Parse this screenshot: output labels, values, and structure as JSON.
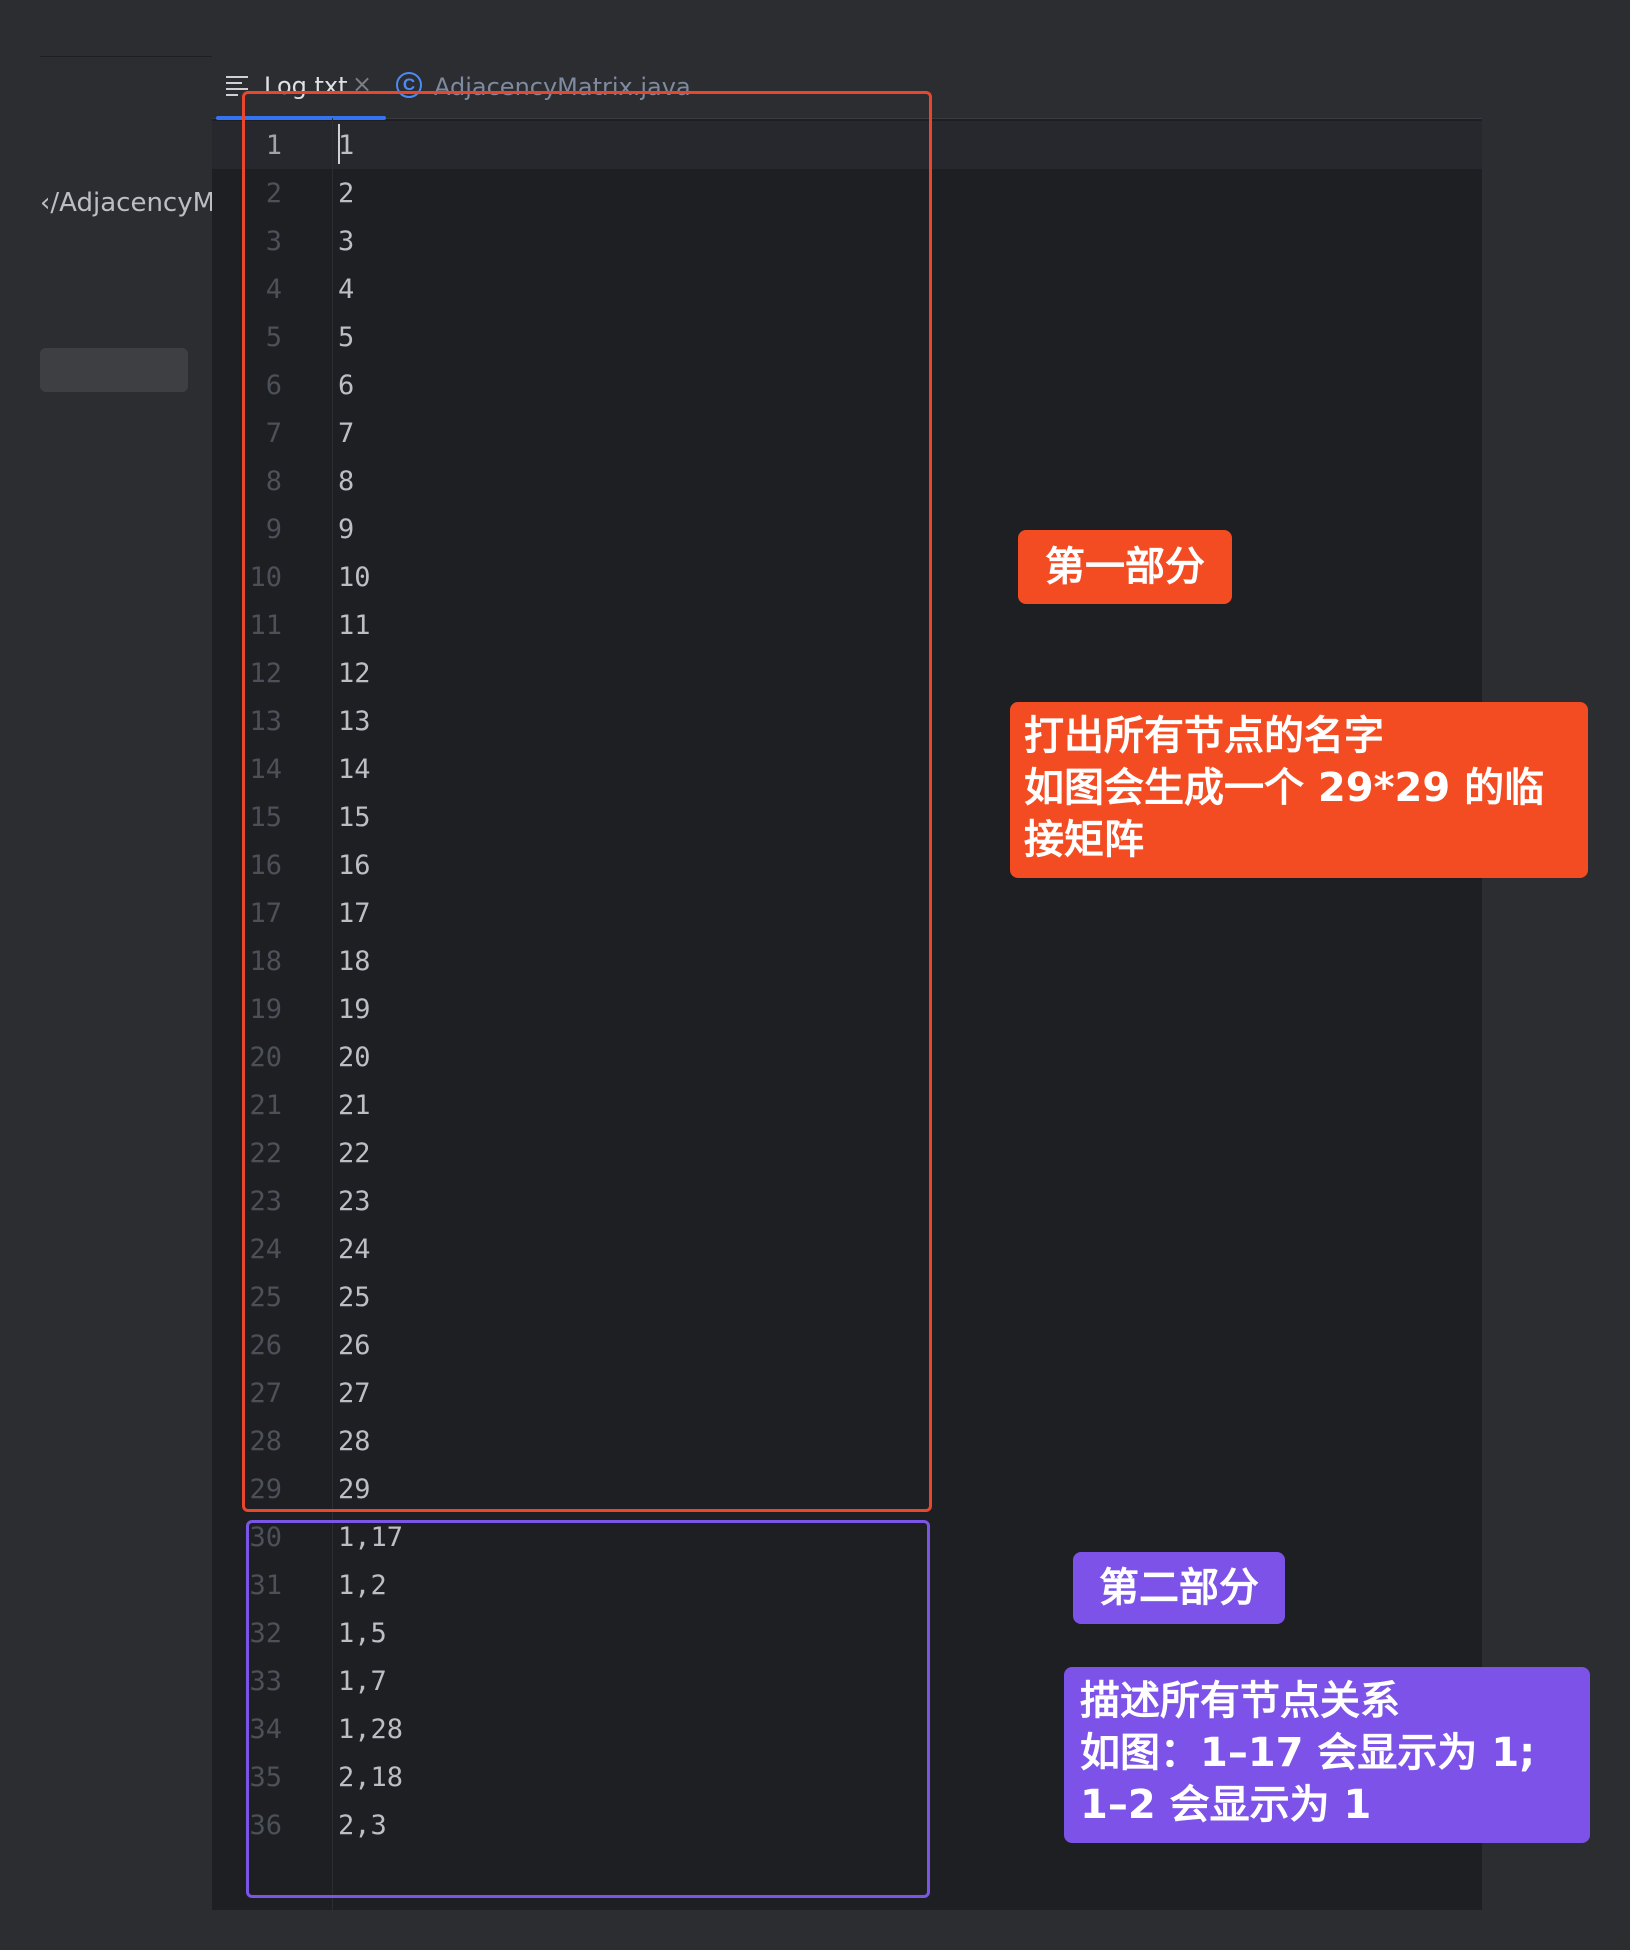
{
  "sidebar": {
    "path_text": "‹/AdjacencyMatrix"
  },
  "tabs": [
    {
      "label": "Log.txt",
      "icon": "text-lines-icon",
      "close": "×"
    },
    {
      "label": "AdjacencyMatrix.java",
      "icon": "class-c-icon",
      "icon_glyph": "C"
    }
  ],
  "editor": {
    "current_line": 1,
    "lines": [
      "1",
      "2",
      "3",
      "4",
      "5",
      "6",
      "7",
      "8",
      "9",
      "10",
      "11",
      "12",
      "13",
      "14",
      "15",
      "16",
      "17",
      "18",
      "19",
      "20",
      "21",
      "22",
      "23",
      "24",
      "25",
      "26",
      "27",
      "28",
      "29",
      "1,17",
      "1,2",
      "1,5",
      "1,7",
      "1,28",
      "2,18",
      "2,3"
    ]
  },
  "annotations": {
    "part1": {
      "title": "第一部分",
      "body": [
        "打出所有节点的名字",
        "如图会生成一个 29*29 的临",
        "接矩阵"
      ]
    },
    "part2": {
      "title": "第二部分",
      "body": [
        "描述所有节点关系",
        "如图：1–17 会显示为 1;",
        "1–2 会显示为 1"
      ]
    }
  },
  "colors": {
    "red_accent": "#f34c23",
    "purple_accent": "#7c52e8",
    "tab_underline": "#3574f0"
  }
}
